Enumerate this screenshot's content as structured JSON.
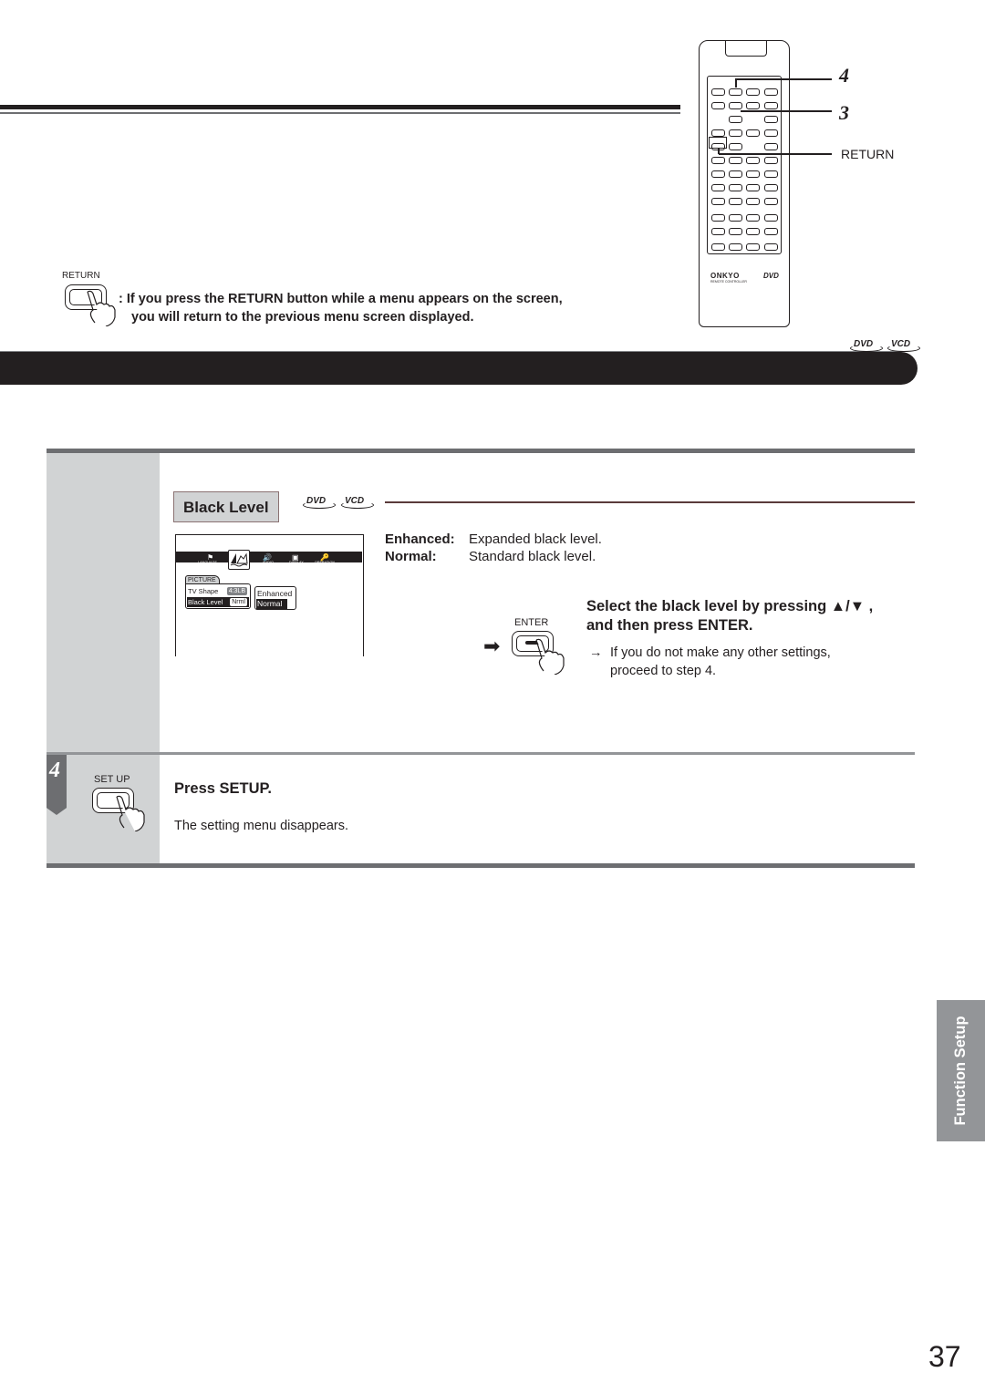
{
  "remote": {
    "brand": "ONKYO",
    "brand_sub": "REMOTE CONTROLLER",
    "disc_logo": "DVD",
    "callouts": [
      {
        "label": "4",
        "target": "setup-button"
      },
      {
        "label": "3",
        "target": "up-down-enter"
      },
      {
        "label": "RETURN",
        "target": "return-button"
      }
    ]
  },
  "return_note": {
    "button_label": "RETURN",
    "line1": ": If you press the RETURN button while a menu appears on the screen,",
    "line2": "you will return to the previous menu screen displayed."
  },
  "banner": {
    "disc_tags": [
      "DVD",
      "VCD"
    ]
  },
  "section": {
    "title": "Black Level",
    "disc_tags": [
      "DVD",
      "VCD"
    ],
    "osd": {
      "icons": [
        {
          "name": "language",
          "label": "LANGUAGE",
          "glyph": "⚑"
        },
        {
          "name": "picture",
          "label": "",
          "glyph": "⛰",
          "selected": true
        },
        {
          "name": "audio",
          "label": "AUDIO",
          "glyph": "🔊"
        },
        {
          "name": "display",
          "label": "DISPLAY",
          "glyph": "▣"
        },
        {
          "name": "operation",
          "label": "OPERATION",
          "glyph": "🔑"
        }
      ],
      "tab": "PICTURE",
      "rows": [
        {
          "label": "TV Shape",
          "value": "4:3LB",
          "highlighted": false
        },
        {
          "label": "Black Level",
          "value": "Nrml",
          "highlighted": true
        }
      ],
      "options": [
        {
          "label": "Enhanced",
          "highlighted": false
        },
        {
          "label": "Normal",
          "highlighted": true
        }
      ]
    },
    "options": [
      {
        "term": "Enhanced:",
        "desc": "Expanded black level."
      },
      {
        "term": "Normal:",
        "desc": "Standard black level."
      }
    ],
    "instruction": {
      "button_label": "ENTER",
      "line1": "Select the black level by pressing ▲/▼ ,",
      "line2": "and then press ENTER.",
      "note_arrow": "→",
      "note_line1": "If you do not make any other settings,",
      "note_line2": "proceed to step 4."
    }
  },
  "step4": {
    "number": "4",
    "button_label": "SET UP",
    "heading": "Press SETUP.",
    "body": "The setting menu disappears."
  },
  "side_tab": "Function Setup",
  "page_number": "37"
}
